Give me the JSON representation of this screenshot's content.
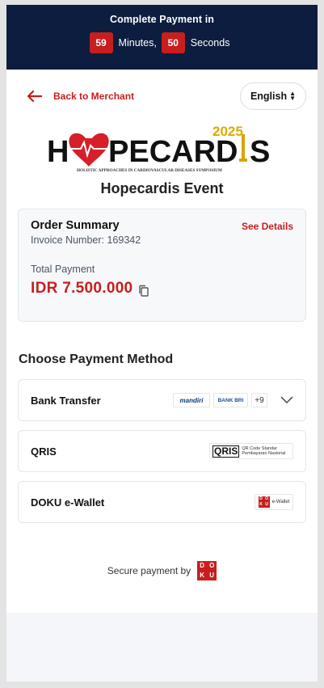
{
  "timer": {
    "title": "Complete Payment in",
    "minutes": "59",
    "minutes_label": "Minutes,",
    "seconds": "50",
    "seconds_label": "Seconds"
  },
  "nav": {
    "back_label": "Back to Merchant",
    "language": "English"
  },
  "logo": {
    "year": "2025",
    "name_left": "H",
    "name_mid": "PECARD",
    "name_right": "S",
    "tagline": "HOLISTIC APPROACHES IN CARDIOVASCULAR DISEASES SYMPOSIUM"
  },
  "event": {
    "title": "Hopecardis Event"
  },
  "order": {
    "title": "Order Summary",
    "see_details": "See Details",
    "invoice": "Invoice Number: 169342",
    "total_label": "Total Payment",
    "total_amount": "IDR 7.500.000"
  },
  "payment": {
    "title": "Choose Payment Method",
    "methods": [
      {
        "label": "Bank Transfer",
        "logos": [
          "mandiri",
          "BANK BRI"
        ],
        "more": "+9"
      },
      {
        "label": "QRIS",
        "logo_text": "QRIS",
        "logo_sub": "QR Code Standar Pembayaran Nasional"
      },
      {
        "label": "DOKU e-Wallet",
        "logo_text": "e-Wallet"
      }
    ]
  },
  "footer": {
    "secure_label": "Secure payment by",
    "brand": [
      "D",
      "O",
      "K",
      "U"
    ]
  },
  "colors": {
    "navy": "#0d1d3f",
    "red": "#c81e1e"
  }
}
